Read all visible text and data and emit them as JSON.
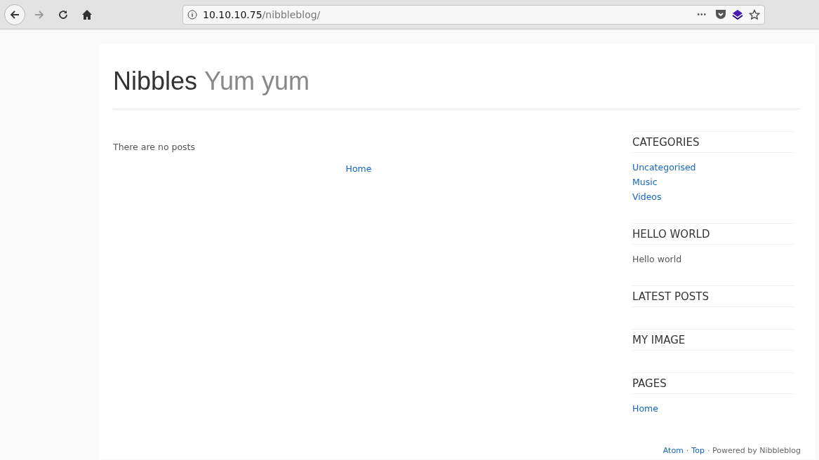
{
  "browser": {
    "url_host": "10.10.10.75",
    "url_path": "/nibbleblog/",
    "page_actions": "•••"
  },
  "header": {
    "title": "Nibbles",
    "subtitle": "Yum yum"
  },
  "main": {
    "message": "There are no posts",
    "pager": [
      {
        "text": "Home"
      }
    ]
  },
  "sidebar": [
    {
      "title": "CATEGORIES",
      "items": [
        {
          "kind": "link",
          "text": "Uncategorised"
        },
        {
          "kind": "link",
          "text": "Music"
        },
        {
          "kind": "link",
          "text": "Videos"
        }
      ]
    },
    {
      "title": "HELLO WORLD",
      "items": [
        {
          "kind": "text",
          "text": "Hello world"
        }
      ]
    },
    {
      "title": "LATEST POSTS"
    },
    {
      "title": "MY IMAGE"
    },
    {
      "title": "PAGES",
      "items": [
        {
          "kind": "link",
          "text": "Home"
        }
      ]
    }
  ],
  "footer": [
    {
      "kind": "link",
      "text": "Atom"
    },
    {
      "kind": "text",
      "text": "·"
    },
    {
      "kind": "link",
      "text": "Top"
    },
    {
      "kind": "text",
      "text": "· Powered by Nibbleblog"
    }
  ]
}
